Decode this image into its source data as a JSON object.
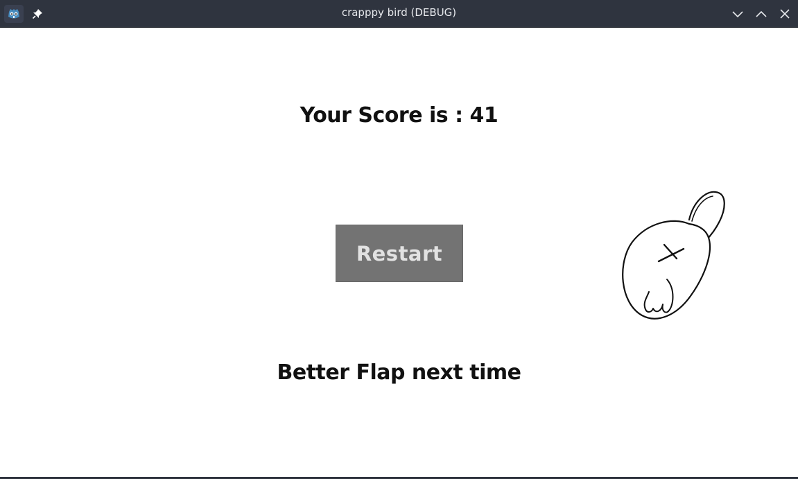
{
  "window": {
    "title": "crapppy bird (DEBUG)",
    "icons": {
      "app": "godot-engine-icon",
      "pin": "pin-icon",
      "minimize": "chevron-down-icon",
      "maximize": "chevron-up-icon",
      "close": "close-icon"
    },
    "colors": {
      "titlebar": "#2f343f",
      "title_text": "#e6e8ec",
      "app_icon_accent": "#478cbf"
    }
  },
  "game": {
    "score_text": "Your Score is : 41",
    "restart_label": "Restart",
    "message": "Better Flap next time",
    "sprite": "dead-bird-sprite",
    "colors": {
      "background": "#ffffff",
      "button_bg": "#737373",
      "button_text": "#e2e2e2",
      "text": "#111111"
    }
  }
}
